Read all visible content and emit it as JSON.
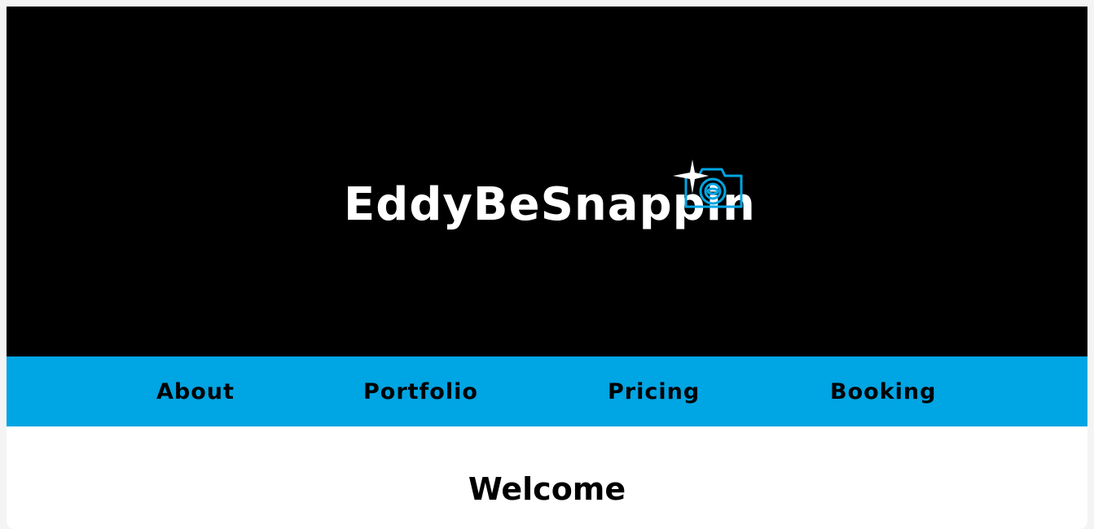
{
  "header": {
    "brand_title": "EddyBeSnappin",
    "logo_icon": "camera-flash-icon"
  },
  "nav": {
    "items": [
      {
        "label": "About"
      },
      {
        "label": "Portfolio"
      },
      {
        "label": "Pricing"
      },
      {
        "label": "Booking"
      }
    ]
  },
  "main": {
    "heading": "Welcome"
  },
  "colors": {
    "hero_background": "#000000",
    "nav_background": "#00a5e3",
    "camera_stroke": "#00a5e3",
    "brand_text": "#ffffff",
    "nav_text": "#000000"
  }
}
